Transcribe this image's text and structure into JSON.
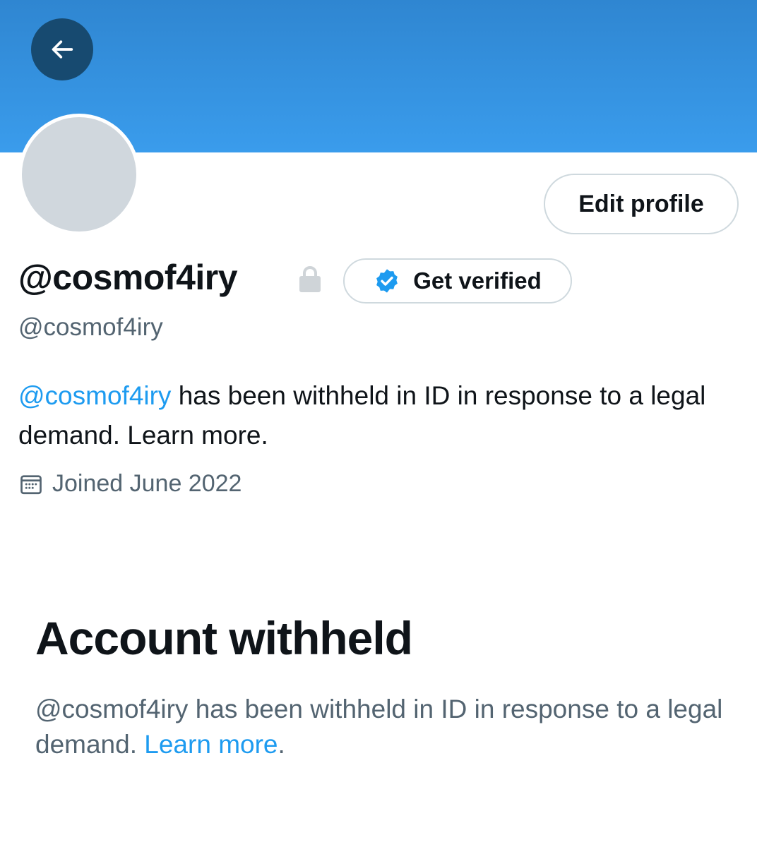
{
  "colors": {
    "banner": "#3a9cec",
    "accent": "#1d9bf0",
    "back_button": "#174a70",
    "text_primary": "#0f1419",
    "text_secondary": "#536471",
    "avatar_placeholder": "#d0d7dd"
  },
  "header": {
    "back_icon": "arrow-left-icon"
  },
  "profile": {
    "edit_button_label": "Edit profile",
    "display_name": "@cosmof4iry",
    "lock_icon": "lock-icon",
    "get_verified": {
      "icon": "verified-badge-icon",
      "label": "Get verified"
    },
    "handle": "@cosmof4iry",
    "bio": {
      "mention": "@cosmof4iry",
      "text": " has been withheld in ID in response to a legal demand. Learn more."
    },
    "joined": {
      "icon": "calendar-icon",
      "text": "Joined June 2022"
    }
  },
  "withheld_notice": {
    "title": "Account withheld",
    "body": "@cosmof4iry has been withheld in ID in response to a legal demand. ",
    "link": "Learn more",
    "suffix": "."
  }
}
